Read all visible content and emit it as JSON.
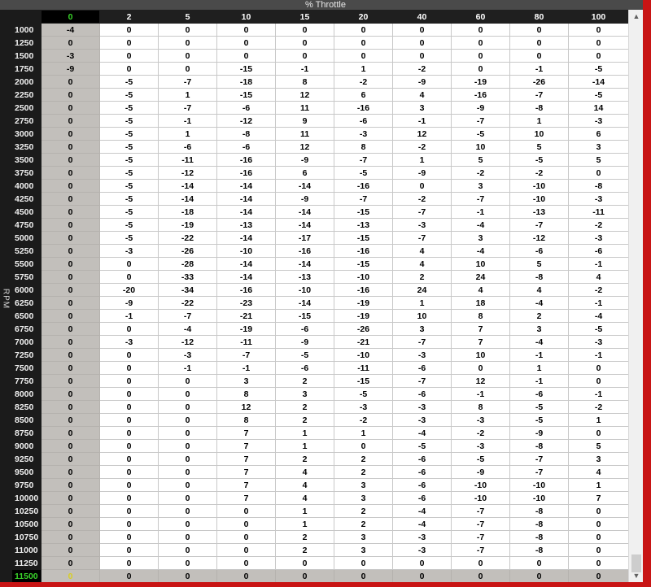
{
  "window": {
    "title": "% Throttle",
    "y_axis_label": "RPM"
  },
  "colors": {
    "active_header": "#39d42a",
    "active_cell_text": "#d8cf22",
    "frame": "#c81414",
    "column_highlight": "#c2bfbb"
  },
  "active": {
    "column": 0,
    "row_rpm": "11500"
  },
  "columns": [
    "0",
    "2",
    "5",
    "10",
    "15",
    "20",
    "40",
    "60",
    "80",
    "100"
  ],
  "rows": [
    {
      "rpm": "1000",
      "values": [
        "-4",
        "0",
        "0",
        "0",
        "0",
        "0",
        "0",
        "0",
        "0",
        "0"
      ]
    },
    {
      "rpm": "1250",
      "values": [
        "0",
        "0",
        "0",
        "0",
        "0",
        "0",
        "0",
        "0",
        "0",
        "0"
      ]
    },
    {
      "rpm": "1500",
      "values": [
        "-3",
        "0",
        "0",
        "0",
        "0",
        "0",
        "0",
        "0",
        "0",
        "0"
      ]
    },
    {
      "rpm": "1750",
      "values": [
        "-9",
        "0",
        "0",
        "-15",
        "-1",
        "1",
        "-2",
        "0",
        "-1",
        "-5"
      ]
    },
    {
      "rpm": "2000",
      "values": [
        "0",
        "-5",
        "-7",
        "-18",
        "8",
        "-2",
        "-9",
        "-19",
        "-26",
        "-14"
      ]
    },
    {
      "rpm": "2250",
      "values": [
        "0",
        "-5",
        "1",
        "-15",
        "12",
        "6",
        "4",
        "-16",
        "-7",
        "-5"
      ]
    },
    {
      "rpm": "2500",
      "values": [
        "0",
        "-5",
        "-7",
        "-6",
        "11",
        "-16",
        "3",
        "-9",
        "-8",
        "14"
      ]
    },
    {
      "rpm": "2750",
      "values": [
        "0",
        "-5",
        "-1",
        "-12",
        "9",
        "-6",
        "-1",
        "-7",
        "1",
        "-3"
      ]
    },
    {
      "rpm": "3000",
      "values": [
        "0",
        "-5",
        "1",
        "-8",
        "11",
        "-3",
        "12",
        "-5",
        "10",
        "6"
      ]
    },
    {
      "rpm": "3250",
      "values": [
        "0",
        "-5",
        "-6",
        "-6",
        "12",
        "8",
        "-2",
        "10",
        "5",
        "3"
      ]
    },
    {
      "rpm": "3500",
      "values": [
        "0",
        "-5",
        "-11",
        "-16",
        "-9",
        "-7",
        "1",
        "5",
        "-5",
        "5"
      ]
    },
    {
      "rpm": "3750",
      "values": [
        "0",
        "-5",
        "-12",
        "-16",
        "6",
        "-5",
        "-9",
        "-2",
        "-2",
        "0"
      ]
    },
    {
      "rpm": "4000",
      "values": [
        "0",
        "-5",
        "-14",
        "-14",
        "-14",
        "-16",
        "0",
        "3",
        "-10",
        "-8"
      ]
    },
    {
      "rpm": "4250",
      "values": [
        "0",
        "-5",
        "-14",
        "-14",
        "-9",
        "-7",
        "-2",
        "-7",
        "-10",
        "-3"
      ]
    },
    {
      "rpm": "4500",
      "values": [
        "0",
        "-5",
        "-18",
        "-14",
        "-14",
        "-15",
        "-7",
        "-1",
        "-13",
        "-11"
      ]
    },
    {
      "rpm": "4750",
      "values": [
        "0",
        "-5",
        "-19",
        "-13",
        "-14",
        "-13",
        "-3",
        "-4",
        "-7",
        "-2"
      ]
    },
    {
      "rpm": "5000",
      "values": [
        "0",
        "-5",
        "-22",
        "-14",
        "-17",
        "-15",
        "-7",
        "3",
        "-12",
        "-3"
      ]
    },
    {
      "rpm": "5250",
      "values": [
        "0",
        "-3",
        "-26",
        "-10",
        "-16",
        "-16",
        "4",
        "-4",
        "-6",
        "-6"
      ]
    },
    {
      "rpm": "5500",
      "values": [
        "0",
        "0",
        "-28",
        "-14",
        "-14",
        "-15",
        "4",
        "10",
        "5",
        "-1"
      ]
    },
    {
      "rpm": "5750",
      "values": [
        "0",
        "0",
        "-33",
        "-14",
        "-13",
        "-10",
        "2",
        "24",
        "-8",
        "4"
      ]
    },
    {
      "rpm": "6000",
      "values": [
        "0",
        "-20",
        "-34",
        "-16",
        "-10",
        "-16",
        "24",
        "4",
        "4",
        "-2"
      ]
    },
    {
      "rpm": "6250",
      "values": [
        "0",
        "-9",
        "-22",
        "-23",
        "-14",
        "-19",
        "1",
        "18",
        "-4",
        "-1"
      ]
    },
    {
      "rpm": "6500",
      "values": [
        "0",
        "-1",
        "-7",
        "-21",
        "-15",
        "-19",
        "10",
        "8",
        "2",
        "-4"
      ]
    },
    {
      "rpm": "6750",
      "values": [
        "0",
        "0",
        "-4",
        "-19",
        "-6",
        "-26",
        "3",
        "7",
        "3",
        "-5"
      ]
    },
    {
      "rpm": "7000",
      "values": [
        "0",
        "-3",
        "-12",
        "-11",
        "-9",
        "-21",
        "-7",
        "7",
        "-4",
        "-3"
      ]
    },
    {
      "rpm": "7250",
      "values": [
        "0",
        "0",
        "-3",
        "-7",
        "-5",
        "-10",
        "-3",
        "10",
        "-1",
        "-1"
      ]
    },
    {
      "rpm": "7500",
      "values": [
        "0",
        "0",
        "-1",
        "-1",
        "-6",
        "-11",
        "-6",
        "0",
        "1",
        "0"
      ]
    },
    {
      "rpm": "7750",
      "values": [
        "0",
        "0",
        "0",
        "3",
        "2",
        "-15",
        "-7",
        "12",
        "-1",
        "0"
      ]
    },
    {
      "rpm": "8000",
      "values": [
        "0",
        "0",
        "0",
        "8",
        "3",
        "-5",
        "-6",
        "-1",
        "-6",
        "-1"
      ]
    },
    {
      "rpm": "8250",
      "values": [
        "0",
        "0",
        "0",
        "12",
        "2",
        "-3",
        "-3",
        "8",
        "-5",
        "-2"
      ]
    },
    {
      "rpm": "8500",
      "values": [
        "0",
        "0",
        "0",
        "8",
        "2",
        "-2",
        "-3",
        "-3",
        "-5",
        "1"
      ]
    },
    {
      "rpm": "8750",
      "values": [
        "0",
        "0",
        "0",
        "7",
        "1",
        "1",
        "-4",
        "-2",
        "-9",
        "0"
      ]
    },
    {
      "rpm": "9000",
      "values": [
        "0",
        "0",
        "0",
        "7",
        "1",
        "0",
        "-5",
        "-3",
        "-8",
        "5"
      ]
    },
    {
      "rpm": "9250",
      "values": [
        "0",
        "0",
        "0",
        "7",
        "2",
        "2",
        "-6",
        "-5",
        "-7",
        "3"
      ]
    },
    {
      "rpm": "9500",
      "values": [
        "0",
        "0",
        "0",
        "7",
        "4",
        "2",
        "-6",
        "-9",
        "-7",
        "4"
      ]
    },
    {
      "rpm": "9750",
      "values": [
        "0",
        "0",
        "0",
        "7",
        "4",
        "3",
        "-6",
        "-10",
        "-10",
        "1"
      ]
    },
    {
      "rpm": "10000",
      "values": [
        "0",
        "0",
        "0",
        "7",
        "4",
        "3",
        "-6",
        "-10",
        "-10",
        "7"
      ]
    },
    {
      "rpm": "10250",
      "values": [
        "0",
        "0",
        "0",
        "0",
        "1",
        "2",
        "-4",
        "-7",
        "-8",
        "0"
      ]
    },
    {
      "rpm": "10500",
      "values": [
        "0",
        "0",
        "0",
        "0",
        "1",
        "2",
        "-4",
        "-7",
        "-8",
        "0"
      ]
    },
    {
      "rpm": "10750",
      "values": [
        "0",
        "0",
        "0",
        "0",
        "2",
        "3",
        "-3",
        "-7",
        "-8",
        "0"
      ]
    },
    {
      "rpm": "11000",
      "values": [
        "0",
        "0",
        "0",
        "0",
        "2",
        "3",
        "-3",
        "-7",
        "-8",
        "0"
      ]
    },
    {
      "rpm": "11250",
      "values": [
        "0",
        "0",
        "0",
        "0",
        "0",
        "0",
        "0",
        "0",
        "0",
        "0"
      ]
    },
    {
      "rpm": "11500",
      "values": [
        "0",
        "0",
        "0",
        "0",
        "0",
        "0",
        "0",
        "0",
        "0",
        "0"
      ]
    }
  ],
  "scrollbar": {
    "up_icon": "arrow-up-icon",
    "down_icon": "arrow-down-icon"
  }
}
